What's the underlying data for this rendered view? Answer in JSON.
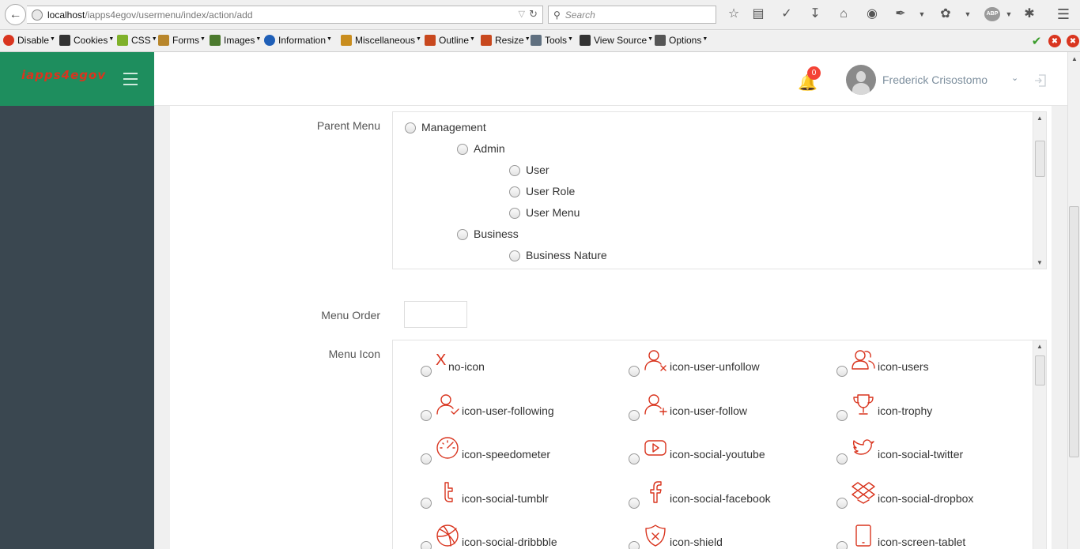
{
  "browser": {
    "url_host": "localhost",
    "url_path": "/iapps4egov/usermenu/index/action/add",
    "search_placeholder": "Search",
    "abp_label": "ABP"
  },
  "devbar": {
    "items": [
      {
        "label": "Disable",
        "icon": "disable-icon",
        "color": "#d9351f"
      },
      {
        "label": "Cookies",
        "icon": "cookies-icon",
        "color": "#333333"
      },
      {
        "label": "CSS",
        "icon": "css-icon",
        "color": "#7fb12a"
      },
      {
        "label": "Forms",
        "icon": "forms-icon",
        "color": "#b8862b"
      },
      {
        "label": "Images",
        "icon": "images-icon",
        "color": "#4c7a2e"
      },
      {
        "label": "Information",
        "icon": "information-icon",
        "color": "#1f5fb7"
      },
      {
        "label": "Miscellaneous",
        "icon": "miscellaneous-icon",
        "color": "#c98d1e"
      },
      {
        "label": "Outline",
        "icon": "outline-icon",
        "color": "#c8481e"
      },
      {
        "label": "Resize",
        "icon": "resize-icon",
        "color": "#c8481e"
      },
      {
        "label": "Tools",
        "icon": "tools-icon",
        "color": "#607080"
      },
      {
        "label": "View Source",
        "icon": "view-source-icon",
        "color": "#333333"
      },
      {
        "label": "Options",
        "icon": "options-icon",
        "color": "#555555"
      }
    ]
  },
  "app": {
    "brand_logo": "iapps4egov",
    "notifications_count": "0",
    "user_name": "Frederick Crisostomo",
    "accent_color": "#1e8e5e",
    "icon_color": "#d9351f"
  },
  "form": {
    "parent_menu_label": "Parent Menu",
    "menu_order_label": "Menu Order",
    "menu_order_value": "",
    "menu_icon_label": "Menu Icon",
    "parent_tree": [
      {
        "label": "Management",
        "level": 0
      },
      {
        "label": "Admin",
        "level": 1
      },
      {
        "label": "User",
        "level": 2
      },
      {
        "label": "User Role",
        "level": 2
      },
      {
        "label": "User Menu",
        "level": 2
      },
      {
        "label": "Business",
        "level": 1
      },
      {
        "label": "Business Nature",
        "level": 2
      }
    ],
    "icons": [
      {
        "label": "no-icon",
        "icon": "x-mark"
      },
      {
        "label": "icon-user-unfollow",
        "icon": "user-unfollow"
      },
      {
        "label": "icon-users",
        "icon": "users"
      },
      {
        "label": "icon-user-following",
        "icon": "user-following"
      },
      {
        "label": "icon-user-follow",
        "icon": "user-follow"
      },
      {
        "label": "icon-trophy",
        "icon": "trophy"
      },
      {
        "label": "icon-speedometer",
        "icon": "speedometer"
      },
      {
        "label": "icon-social-youtube",
        "icon": "youtube"
      },
      {
        "label": "icon-social-twitter",
        "icon": "twitter"
      },
      {
        "label": "icon-social-tumblr",
        "icon": "tumblr"
      },
      {
        "label": "icon-social-facebook",
        "icon": "facebook"
      },
      {
        "label": "icon-social-dropbox",
        "icon": "dropbox"
      },
      {
        "label": "icon-social-dribbble",
        "icon": "dribbble"
      },
      {
        "label": "icon-shield",
        "icon": "shield"
      },
      {
        "label": "icon-screen-tablet",
        "icon": "tablet"
      }
    ]
  }
}
